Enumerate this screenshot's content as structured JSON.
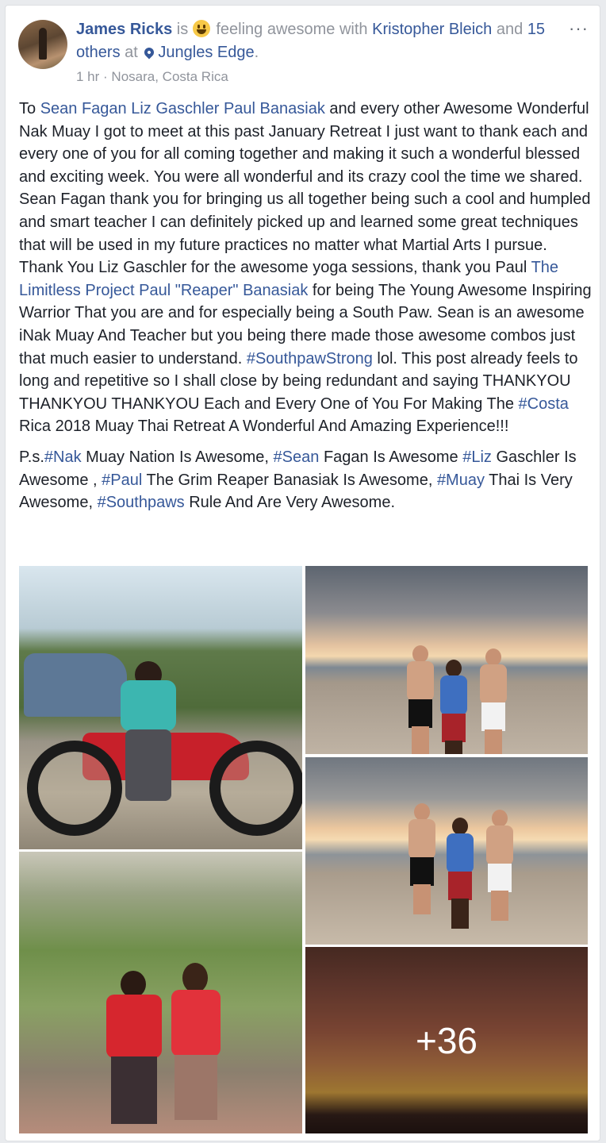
{
  "post": {
    "author": "James Ricks",
    "is_word": "is",
    "feeling": "feeling awesome with",
    "tagged_person": "Kristopher Bleich",
    "and_word": "and",
    "others": "15 others",
    "at_word": "at",
    "place": "Jungles Edge",
    "period": ".",
    "time": "1 hr",
    "location": "Nosara, Costa Rica",
    "more_glyph": "···",
    "emoji_icon": "grinning-face-icon",
    "location_icon": "map-pin-icon",
    "paragraph1": [
      {
        "text": "To ",
        "link": false
      },
      {
        "text": "Sean Fagan",
        "link": true
      },
      {
        "text": " ",
        "link": false
      },
      {
        "text": "Liz Gaschler",
        "link": true
      },
      {
        "text": " ",
        "link": false
      },
      {
        "text": "Paul Banasiak",
        "link": true
      },
      {
        "text": " and every other Awesome Wonderful Nak Muay I got to meet at this past January Retreat I just want to thank each and every one of you for all coming together and making it such a wonderful blessed and exciting week. You were all wonderful and its crazy cool the time we shared. Sean Fagan thank you for bringing us all together being such a cool and humpled and smart teacher I can definitely picked up and learned some great techniques that will be used in my future practices no matter what Martial Arts I pursue. Thank You Liz Gaschler for the awesome yoga sessions, thank you Paul ",
        "link": false
      },
      {
        "text": "The Limitless Project Paul \"Reaper\" Banasiak",
        "link": true
      },
      {
        "text": " for being The Young Awesome Inspiring Warrior That you are and for especially being a South Paw. Sean is an awesome iNak Muay And Teacher but you being there made those awesome combos just that much easier to understand. ",
        "link": false
      },
      {
        "text": "#SouthpawStrong",
        "link": true
      },
      {
        "text": " lol. This post already feels to long and repetitive so I shall close by being redundant and saying THANKYOU THANKYOU THANKYOU Each and Every One of You For Making The ",
        "link": false
      },
      {
        "text": "#Costa",
        "link": true
      },
      {
        "text": " Rica 2018 Muay Thai Retreat A Wonderful And Amazing Experience!!!",
        "link": false
      }
    ],
    "paragraph2": [
      {
        "text": "P.s.",
        "link": false
      },
      {
        "text": "#Nak",
        "link": true
      },
      {
        "text": " Muay Nation Is Awesome, ",
        "link": false
      },
      {
        "text": "#Sean",
        "link": true
      },
      {
        "text": " Fagan Is Awesome ",
        "link": false
      },
      {
        "text": "#Liz",
        "link": true
      },
      {
        "text": " Gaschler Is Awesome , ",
        "link": false
      },
      {
        "text": "#Paul",
        "link": true
      },
      {
        "text": " The Grim Reaper Banasiak Is Awesome, ",
        "link": false
      },
      {
        "text": "#Muay",
        "link": true
      },
      {
        "text": " Thai Is Very Awesome, ",
        "link": false
      },
      {
        "text": "#Southpaws",
        "link": true
      },
      {
        "text": " Rule And Are Very Awesome.",
        "link": false
      }
    ],
    "more_photos": "+36"
  }
}
